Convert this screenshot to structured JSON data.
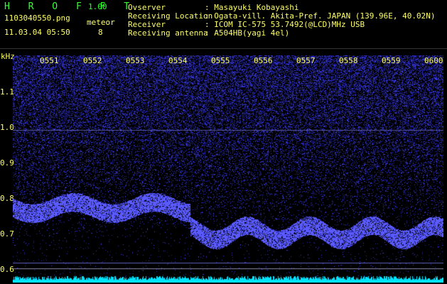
{
  "app": {
    "name": "H R O F F T",
    "version": "1.00"
  },
  "file": {
    "name": "1103040550.png",
    "datetime": "11.03.04 05:50"
  },
  "meteor": {
    "label": "meteor",
    "count": "8"
  },
  "info": [
    {
      "label": "Ovserver",
      "value": ": Masayuki Kobayashi"
    },
    {
      "label": "Receiving Location",
      "value": ": Ogata-vill. Akita-Pref. JAPAN (139.96E, 40.02N)"
    },
    {
      "label": "Receiver",
      "value": ": ICOM IC-575 53.7492(@LCD)MHz USB"
    },
    {
      "label": "Receiving antenna",
      "value": ": A504HB(yagi 4el)"
    }
  ],
  "axis": {
    "unit": "kHz",
    "y_ticks": [
      "1.1",
      "1.0",
      "0.9",
      "0.8",
      "0.7",
      "0.6"
    ],
    "x_ticks": [
      "0551",
      "0552",
      "0553",
      "0554",
      "0555",
      "0556",
      "0557",
      "0558",
      "0559",
      "0600"
    ]
  },
  "colors": {
    "label": "#ffff66",
    "title": "#33ff33",
    "signal": "#3a3aff",
    "noise_band": "#00e5ff"
  }
}
